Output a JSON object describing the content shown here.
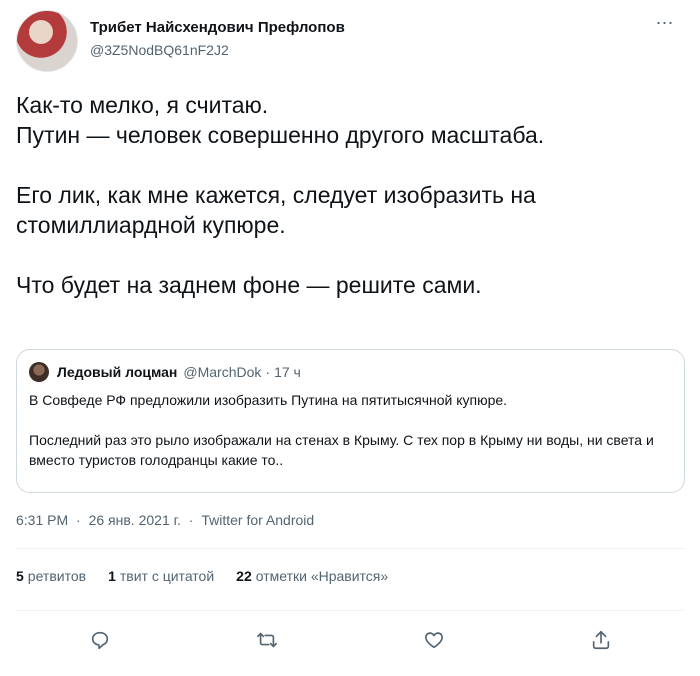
{
  "author": {
    "display_name": "Трибет Найсхендович Префлопов",
    "handle": "@3Z5NodBQ61nF2J2"
  },
  "menu_icon": "more-horizontal-icon",
  "tweet": {
    "lines": [
      "Как-то мелко, я считаю.",
      "Путин — человек совершенно другого масштаба.",
      "Его лик, как мне кажется, следует изобразить на",
      "стомиллиардной купюре.",
      "Что будет на заднем фоне — решите сами."
    ]
  },
  "quoted": {
    "display_name": "Ледовый лоцман",
    "handle": "@MarchDok",
    "separator": "·",
    "time": "17 ч",
    "paragraph1": "В Совфеде РФ предложили изобразить Путина на пятитысячной купюре.",
    "paragraph2": "Последний раз это рыло изображали на стенах в Крыму. С тех пор в Крыму ни воды, ни света и вместо туристов голодранцы какие то.."
  },
  "meta": {
    "time": "6:31 PM",
    "sep": "·",
    "date": "26 янв. 2021 г.",
    "source": "Twitter for Android"
  },
  "stats": {
    "retweets_count": "5",
    "retweets_label": "ретвитов",
    "quotes_count": "1",
    "quotes_label": "твит с цитатой",
    "likes_count": "22",
    "likes_label": "отметки «Нравится»"
  },
  "actions": [
    "reply-icon",
    "retweet-icon",
    "like-icon",
    "share-icon"
  ],
  "colors": {
    "text": "#0f1419",
    "secondary": "#536471",
    "border": "#cfd9de"
  }
}
